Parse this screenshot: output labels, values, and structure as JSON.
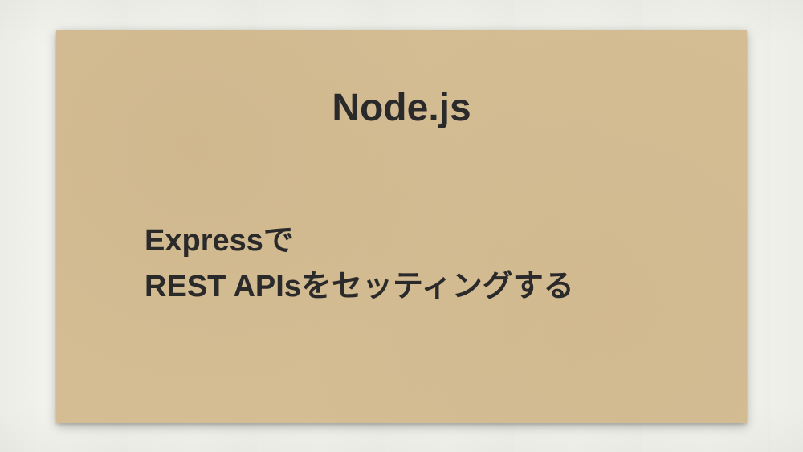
{
  "card": {
    "title": "Node.js",
    "subtitle_line1": "Expressで",
    "subtitle_line2": "REST APIsをセッティングする"
  }
}
